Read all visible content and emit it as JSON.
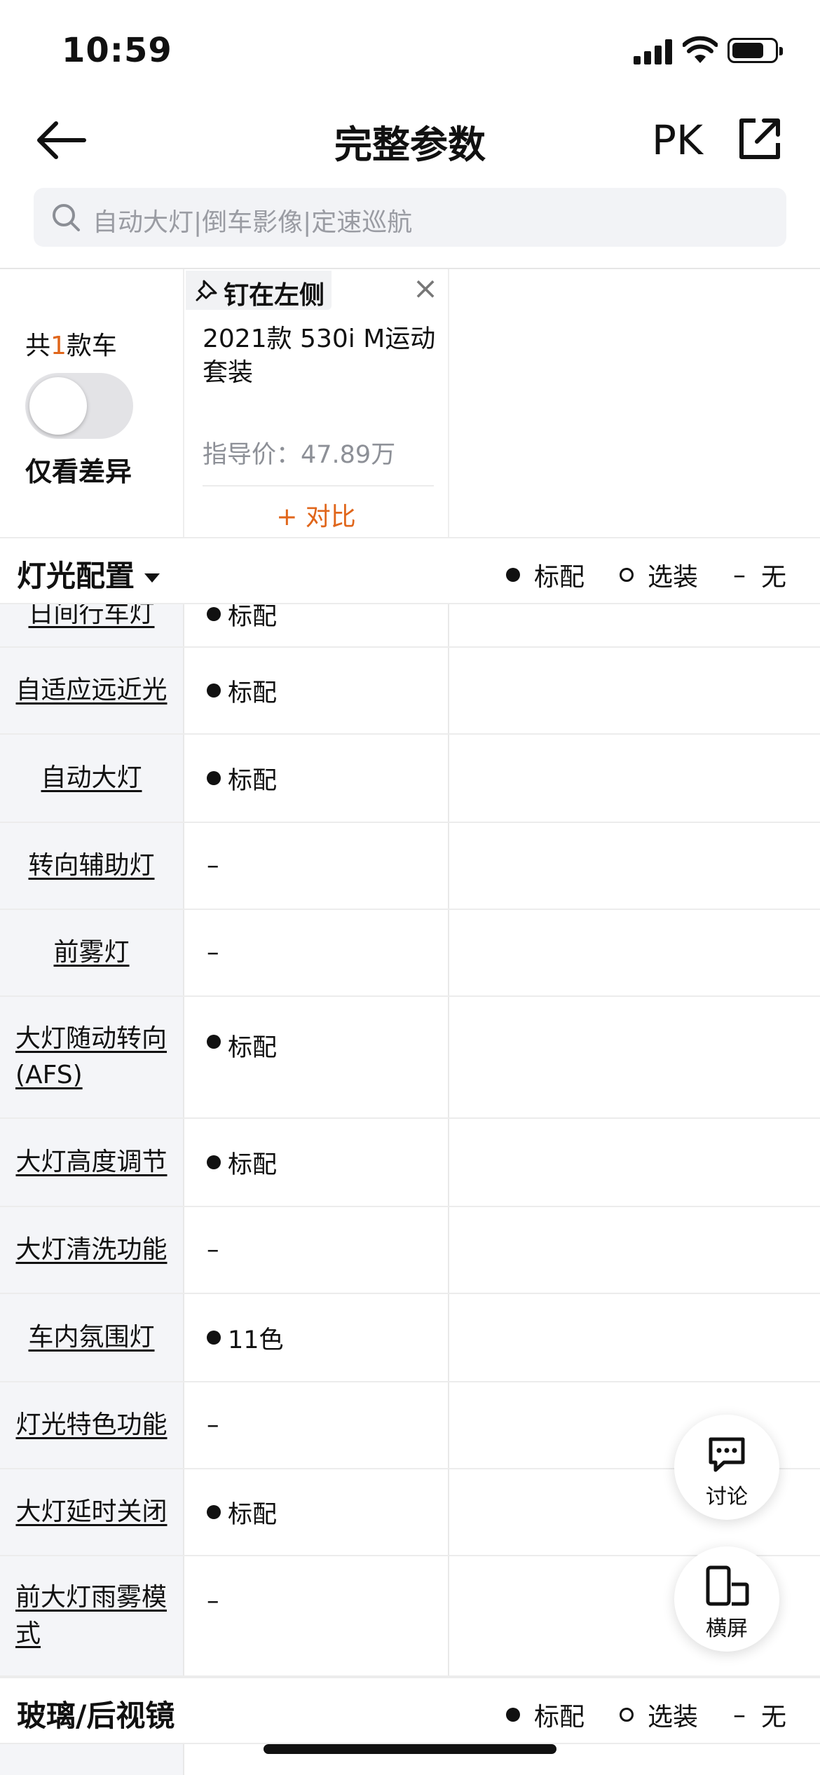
{
  "status": {
    "time": "10:59"
  },
  "nav": {
    "title": "完整参数",
    "pk": "PK"
  },
  "search": {
    "placeholder": "自动大灯|倒车影像|定速巡航"
  },
  "summary": {
    "count_prefix": "共",
    "count": "1",
    "count_suffix": "款车",
    "only_diff": "仅看差异",
    "only_diff_on": false
  },
  "car": {
    "pin_label": "钉在左侧",
    "name": "2021款 530i M运动套装",
    "price": "指导价：47.89万",
    "compare": "+ 对比"
  },
  "legend": {
    "std": "标配",
    "opt": "选装",
    "none_symbol": "–",
    "none": "无"
  },
  "sections": [
    {
      "name": "灯光配置",
      "has_caret": true
    },
    {
      "name": "玻璃/后视镜",
      "has_caret": false
    }
  ],
  "partial_row": {
    "label": "日间行车灯",
    "value": "标配"
  },
  "rows": [
    {
      "label": "自适应远近光",
      "value": "标配",
      "dot": true
    },
    {
      "label": "自动大灯",
      "value": "标配",
      "dot": true
    },
    {
      "label": "转向辅助灯",
      "value": "–",
      "dot": false
    },
    {
      "label": "前雾灯",
      "value": "–",
      "dot": false
    },
    {
      "label": "大灯随动转向(AFS)",
      "value": "标配",
      "dot": true
    },
    {
      "label": "大灯高度调节",
      "value": "标配",
      "dot": true
    },
    {
      "label": "大灯清洗功能",
      "value": "–",
      "dot": false
    },
    {
      "label": "车内氛围灯",
      "value": "11色",
      "dot": true
    },
    {
      "label": "灯光特色功能",
      "value": "–",
      "dot": false
    },
    {
      "label": "大灯延时关闭",
      "value": "标配",
      "dot": true
    },
    {
      "label": "前大灯雨雾模式",
      "value": "–",
      "dot": false
    }
  ],
  "fabs": {
    "discuss": "讨论",
    "landscape": "横屏"
  }
}
